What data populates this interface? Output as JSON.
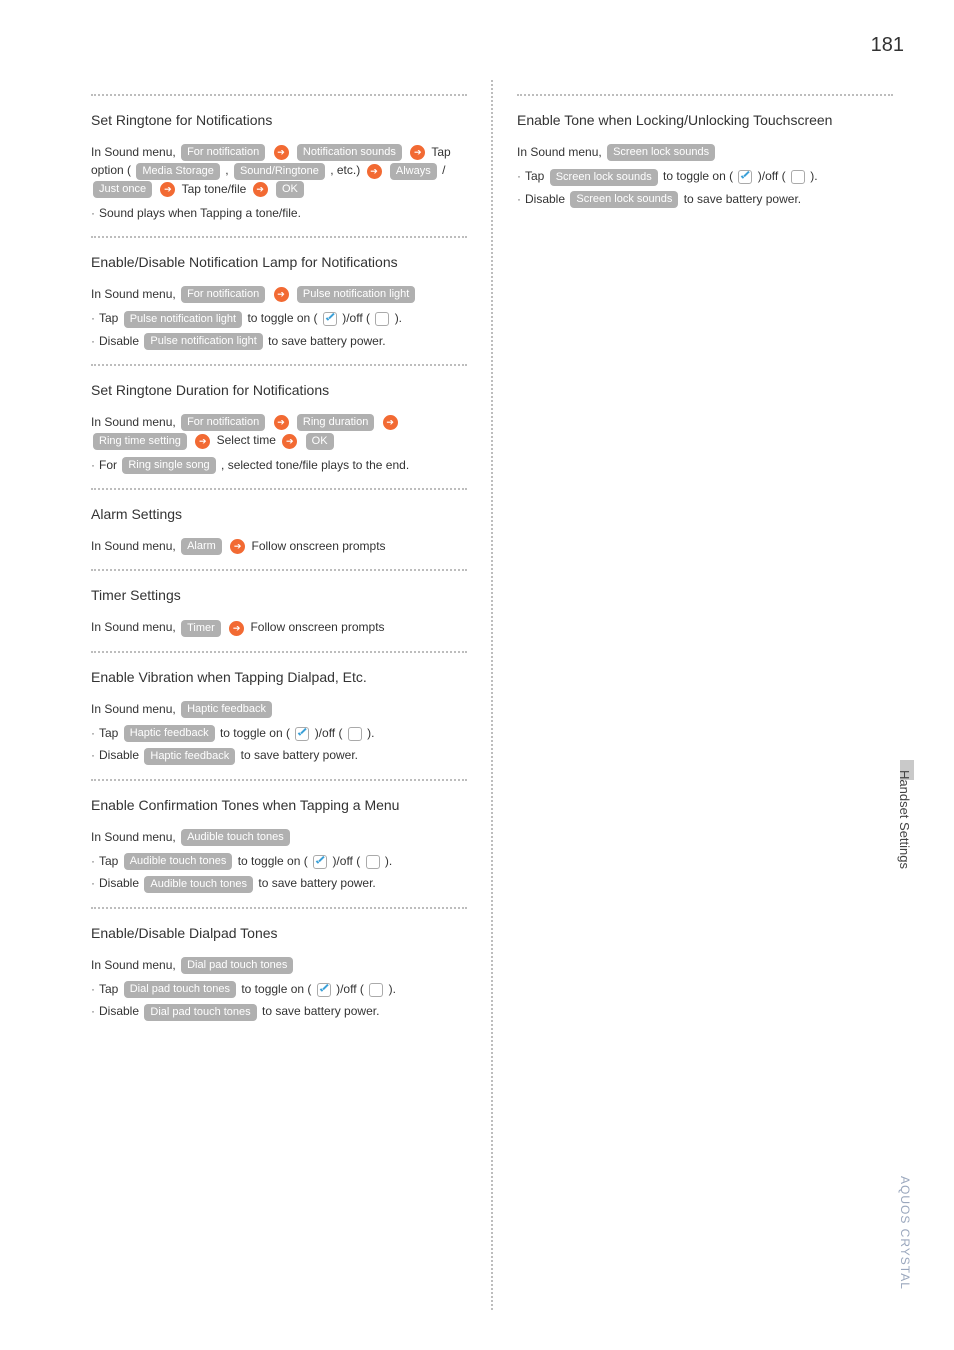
{
  "page_number": "181",
  "side_tab": "Handset Settings",
  "brand": "AQUOS CRYSTAL",
  "txt": {
    "in_sound_menu": "In Sound menu,",
    "tap_option": "Tap option (",
    "etc": ", etc.)",
    "slash": "/",
    "tap": "Tap",
    "tonefile": "tone/file",
    "tap_prefix": "Tap",
    "toggle_on": "to toggle on (",
    "off_open": ")/off (",
    "close_paren": ").",
    "disable_prefix": "Disable",
    "save_battery": "to save battery power.",
    "select_time": "Select time",
    "for": "For",
    "plays_end": ", selected tone/file plays to the end.",
    "follow_prompts": "Follow onscreen prompts",
    "comma": ","
  },
  "chips": {
    "for_notification": "For notification",
    "notification_sounds": "Notification sounds",
    "media_storage": "Media Storage",
    "sound_ringtone": "Sound/Ringtone",
    "always": "Always",
    "just_once": "Just once",
    "ok": "OK",
    "pulse_notification_light": "Pulse notification light",
    "ring_duration": "Ring duration",
    "ring_time_setting": "Ring time setting",
    "ring_single_song": "Ring single song",
    "alarm": "Alarm",
    "timer": "Timer",
    "haptic_feedback": "Haptic feedback",
    "audible_touch_tones": "Audible touch tones",
    "dial_pad_touch_tones": "Dial pad touch tones",
    "screen_lock_sounds": "Screen lock sounds"
  },
  "sections": {
    "s1": {
      "title": "Set Ringtone for Notifications",
      "note": "Sound plays when Tapping a tone/file."
    },
    "s2": {
      "title": "Enable/Disable Notification Lamp for Notifications"
    },
    "s3": {
      "title": "Set Ringtone Duration for Notifications"
    },
    "s4": {
      "title": "Alarm Settings"
    },
    "s5": {
      "title": "Timer Settings"
    },
    "s6": {
      "title": "Enable Vibration when Tapping Dialpad, Etc."
    },
    "s7": {
      "title": "Enable Confirmation Tones when Tapping a Menu"
    },
    "s8": {
      "title": "Enable/Disable Dialpad Tones"
    },
    "s9": {
      "title": "Enable Tone when Locking/Unlocking Touchscreen"
    }
  }
}
